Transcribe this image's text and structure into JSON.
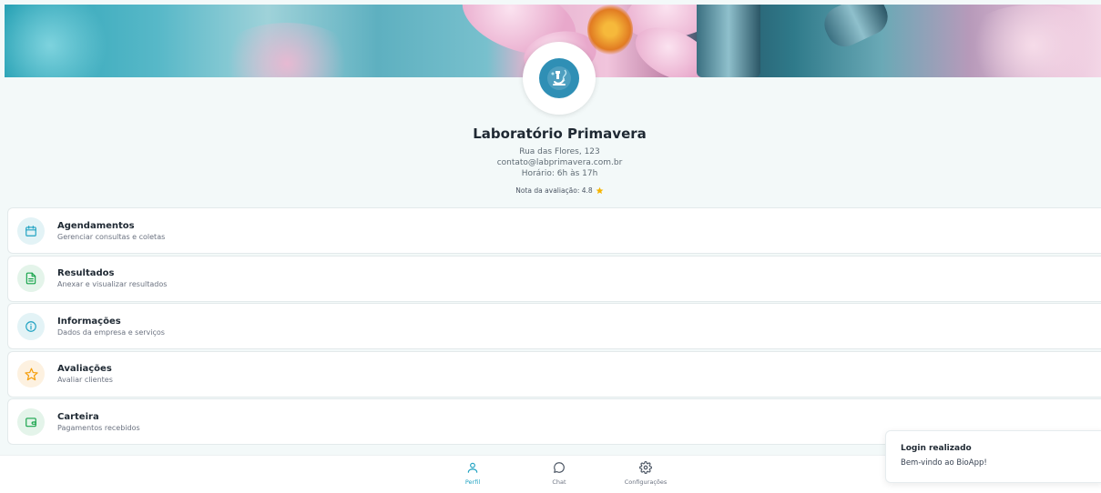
{
  "profile": {
    "name": "Laboratório Primavera",
    "address": "Rua das Flores, 123",
    "email": "contato@labprimavera.com.br",
    "hours": "Horário: 6h às 17h",
    "rating_text": "Nota da avaliação: 4.8",
    "rating_value": 4.8
  },
  "menu": [
    {
      "title": "Agendamentos",
      "subtitle": "Gerenciar consultas e coletas",
      "icon": "calendar-icon",
      "color": "#1fa2c2",
      "bg": "#e3f3f6"
    },
    {
      "title": "Resultados",
      "subtitle": "Anexar e visualizar resultados",
      "icon": "file-text-icon",
      "color": "#16a34a",
      "bg": "#e4f4ea"
    },
    {
      "title": "Informações",
      "subtitle": "Dados da empresa e serviços",
      "icon": "info-icon",
      "color": "#1fa2c2",
      "bg": "#e3f3f6"
    },
    {
      "title": "Avaliações",
      "subtitle": "Avaliar clientes",
      "icon": "star-icon",
      "color": "#f59e0b",
      "bg": "#fdf1e0"
    },
    {
      "title": "Carteira",
      "subtitle": "Pagamentos recebidos",
      "icon": "wallet-icon",
      "color": "#16a34a",
      "bg": "#e4f4ea"
    }
  ],
  "nav": {
    "profile_label": "Perfil",
    "chat_label": "Chat",
    "settings_label": "Configurações",
    "active_color": "#1fa2c2"
  },
  "toast": {
    "title": "Login realizado",
    "message": "Bem-vindo ao BioApp!"
  }
}
